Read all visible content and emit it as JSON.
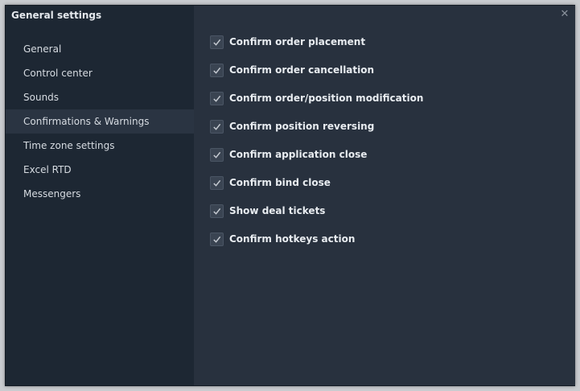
{
  "window": {
    "title": "General settings",
    "close_glyph": "✕"
  },
  "sidebar": {
    "items": [
      {
        "label": "General"
      },
      {
        "label": "Control center"
      },
      {
        "label": "Sounds"
      },
      {
        "label": "Confirmations & Warnings",
        "active": true
      },
      {
        "label": "Time zone settings"
      },
      {
        "label": "Excel RTD"
      },
      {
        "label": "Messengers"
      }
    ]
  },
  "options": [
    {
      "label": "Confirm order placement",
      "checked": true
    },
    {
      "label": "Confirm order cancellation",
      "checked": true
    },
    {
      "label": "Confirm order/position modification",
      "checked": true
    },
    {
      "label": "Confirm position reversing",
      "checked": true
    },
    {
      "label": "Confirm application close",
      "checked": true
    },
    {
      "label": "Confirm bind close",
      "checked": true
    },
    {
      "label": "Show deal tickets",
      "checked": true
    },
    {
      "label": "Confirm hotkeys action",
      "checked": true
    }
  ],
  "colors": {
    "sidebar_bg": "#1d2733",
    "content_bg": "#28313e",
    "active_item_bg": "#2a3442",
    "checkmark": "#c7ccd3"
  }
}
